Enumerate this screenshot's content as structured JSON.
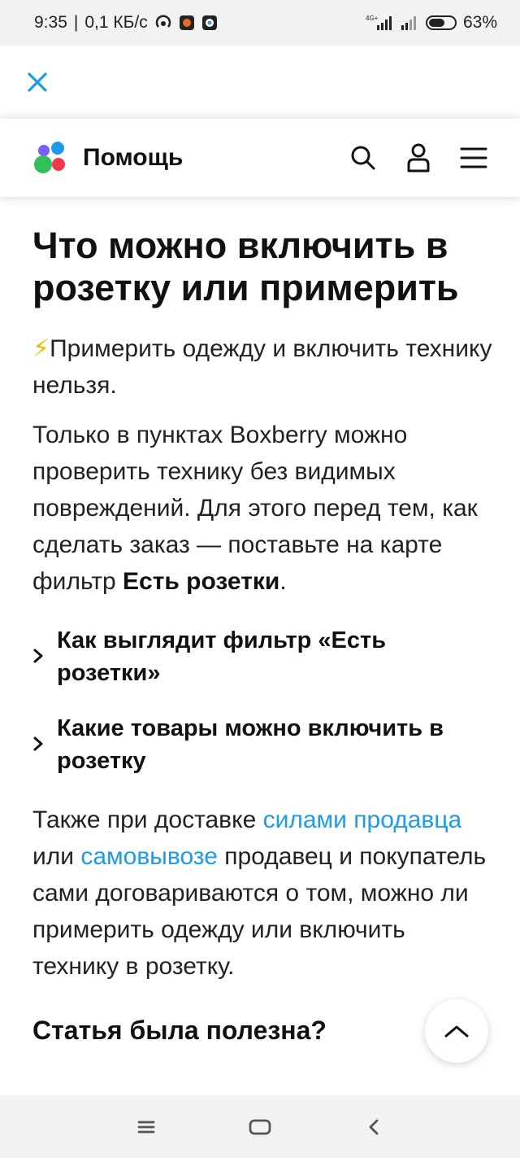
{
  "status_bar": {
    "time": "9:35",
    "network_speed": "0,1 КБ/с",
    "network_type": "4G+",
    "battery": "63%",
    "battery_level": 0.63,
    "icons": [
      "hotspot-icon",
      "notification-app-icon",
      "notification-app-icon-2",
      "signal-icon",
      "signal-icon-2",
      "battery-icon"
    ]
  },
  "close_bar": {
    "icon": "close-icon",
    "color": "#1e9be8"
  },
  "header": {
    "brand": "Помощь",
    "logo_colors": [
      "#7c5cf7",
      "#1e9be8",
      "#2ec05a",
      "#f5374e"
    ],
    "icons": [
      "search-icon",
      "profile-icon",
      "menu-icon"
    ]
  },
  "article": {
    "title": "Что можно включить в розетку или примерить",
    "emoji": "⚡",
    "intro": "Примерить одежду и включить технику нельзя.",
    "para2_text": "Только в пунктах Boxberry можно проверить технику без видимых повреждений. Для этого перед тем, как сделать заказ — поставьте на карте фильтр ",
    "para2_bold": "Есть розетки",
    "para2_end": ".",
    "accordions": [
      {
        "label": "Как выглядит фильтр «Есть розетки»"
      },
      {
        "label": "Какие товары можно включить в розетку"
      }
    ],
    "para3_start": "Также при доставке ",
    "para3_link1": "силами продавца",
    "para3_mid": " или ",
    "para3_link2": "самовывозе",
    "para3_end": " продавец и покупатель сами договариваются о том, можно ли примерить одежду или включить технику в розетку.",
    "link_color": "#1e9be8",
    "feedback_title": "Статья была полезна?"
  },
  "scroll_up": {
    "icon": "chevron-up-icon"
  },
  "nav_bar": {
    "icons": [
      "recent-apps-icon",
      "home-icon",
      "back-icon"
    ]
  }
}
